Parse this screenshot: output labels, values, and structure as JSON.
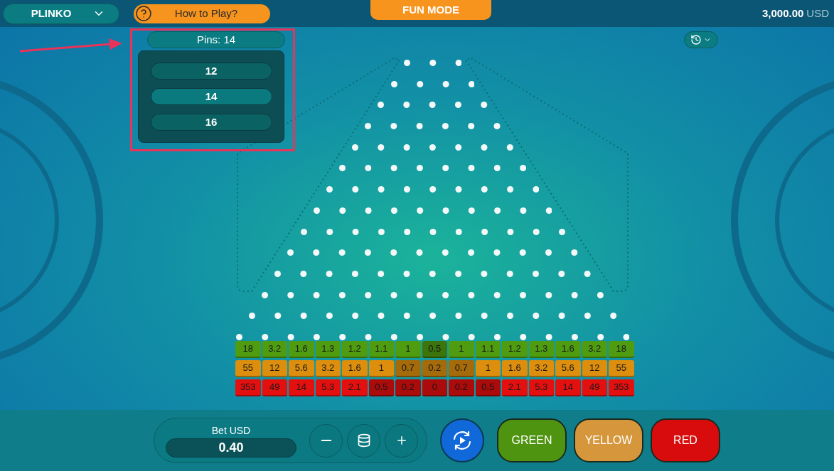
{
  "game_menu": {
    "label": "PLINKO"
  },
  "help_button": {
    "label": "How to Play?"
  },
  "mode_badge": {
    "label": "FUN MODE"
  },
  "balance": {
    "amount": "3,000.00",
    "currency": "USD"
  },
  "pins_menu": {
    "label": "Pins: 14",
    "expanded": true,
    "options": [
      {
        "label": "12",
        "selected": false
      },
      {
        "label": "14",
        "selected": true
      },
      {
        "label": "16",
        "selected": false
      }
    ]
  },
  "multiplier_rows": [
    {
      "color": "#4f9c10",
      "cells": [
        {
          "value": "18",
          "dim": false
        },
        {
          "value": "3.2",
          "dim": false
        },
        {
          "value": "1.6",
          "dim": false
        },
        {
          "value": "1.3",
          "dim": false
        },
        {
          "value": "1.2",
          "dim": false
        },
        {
          "value": "1.1",
          "dim": false
        },
        {
          "value": "1",
          "dim": false
        },
        {
          "value": "0.5",
          "dim": true
        },
        {
          "value": "1",
          "dim": false
        },
        {
          "value": "1.1",
          "dim": false
        },
        {
          "value": "1.2",
          "dim": false
        },
        {
          "value": "1.3",
          "dim": false
        },
        {
          "value": "1.6",
          "dim": false
        },
        {
          "value": "3.2",
          "dim": false
        },
        {
          "value": "18",
          "dim": false
        }
      ]
    },
    {
      "color": "#dc8e0c",
      "cells": [
        {
          "value": "55",
          "dim": false
        },
        {
          "value": "12",
          "dim": false
        },
        {
          "value": "5.6",
          "dim": false
        },
        {
          "value": "3.2",
          "dim": false
        },
        {
          "value": "1.6",
          "dim": false
        },
        {
          "value": "1",
          "dim": false
        },
        {
          "value": "0.7",
          "dim": true
        },
        {
          "value": "0.2",
          "dim": true
        },
        {
          "value": "0.7",
          "dim": true
        },
        {
          "value": "1",
          "dim": false
        },
        {
          "value": "1.6",
          "dim": false
        },
        {
          "value": "3.2",
          "dim": false
        },
        {
          "value": "5.6",
          "dim": false
        },
        {
          "value": "12",
          "dim": false
        },
        {
          "value": "55",
          "dim": false
        }
      ]
    },
    {
      "color": "#e4100f",
      "cells": [
        {
          "value": "353",
          "dim": false
        },
        {
          "value": "49",
          "dim": false
        },
        {
          "value": "14",
          "dim": false
        },
        {
          "value": "5.3",
          "dim": false
        },
        {
          "value": "2.1",
          "dim": false
        },
        {
          "value": "0.5",
          "dim": true
        },
        {
          "value": "0.2",
          "dim": true
        },
        {
          "value": "0",
          "dim": true
        },
        {
          "value": "0.2",
          "dim": true
        },
        {
          "value": "0.5",
          "dim": true
        },
        {
          "value": "2.1",
          "dim": false
        },
        {
          "value": "5.3",
          "dim": false
        },
        {
          "value": "14",
          "dim": false
        },
        {
          "value": "49",
          "dim": false
        },
        {
          "value": "353",
          "dim": false
        }
      ]
    }
  ],
  "bet": {
    "label": "Bet USD",
    "value": "0.40"
  },
  "play_buttons": [
    {
      "label": "GREEN",
      "color": "#4f9410"
    },
    {
      "label": "YELLOW",
      "color": "#d6963c"
    },
    {
      "label": "RED",
      "color": "#d80c0c"
    }
  ]
}
